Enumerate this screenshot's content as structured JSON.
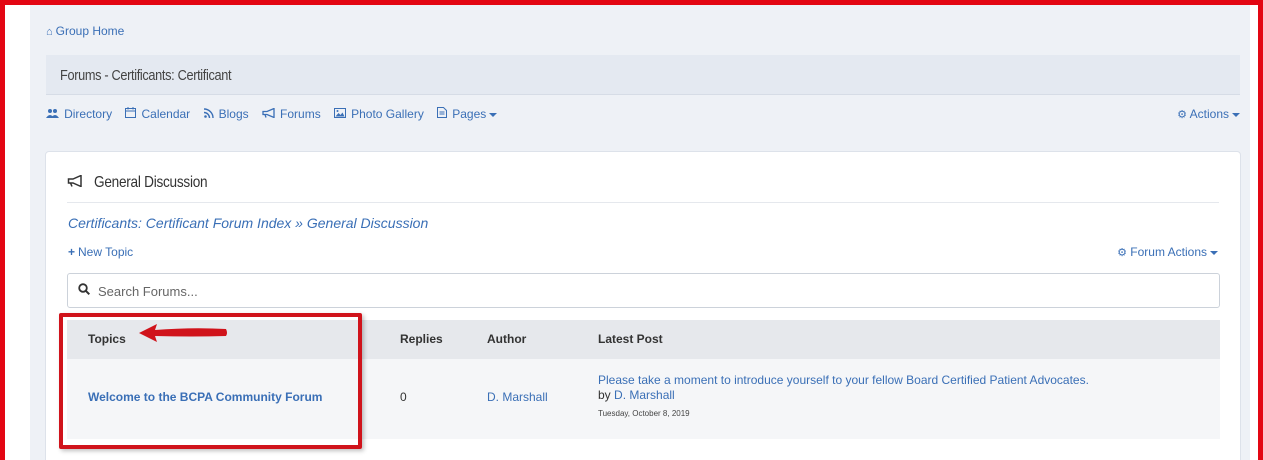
{
  "top": {
    "group_home": "Group Home"
  },
  "titlebar": {
    "title": "Forums - Certificants: Certificant"
  },
  "nav": {
    "items": [
      {
        "label": "Directory",
        "icon": "users-icon"
      },
      {
        "label": "Calendar",
        "icon": "calendar-icon"
      },
      {
        "label": "Blogs",
        "icon": "rss-icon"
      },
      {
        "label": "Forums",
        "icon": "bullhorn-icon"
      },
      {
        "label": "Photo Gallery",
        "icon": "image-icon"
      },
      {
        "label": "Pages",
        "icon": "document-icon"
      }
    ],
    "actions_label": "Actions"
  },
  "panel": {
    "title": "General Discussion",
    "breadcrumb": "Certificants: Certificant Forum Index » General Discussion",
    "new_topic": "New Topic",
    "forum_actions": "Forum Actions",
    "search_placeholder": "Search Forums..."
  },
  "table": {
    "headers": [
      "Topics",
      "Replies",
      "Author",
      "Latest Post"
    ],
    "rows": [
      {
        "topic": "Welcome to the BCPA Community Forum",
        "replies": "0",
        "author": "D. Marshall",
        "latest_message": "Please take a moment to introduce yourself to your fellow Board Certified Patient Advocates.",
        "latest_by": "by",
        "latest_author": "D. Marshall",
        "latest_date": "Tuesday, October 8, 2019"
      }
    ]
  },
  "colors": {
    "link": "#3a6fb6",
    "annotation_red": "#d0131b",
    "frame_red": "#e30613",
    "page_bg": "#eef1f6"
  }
}
